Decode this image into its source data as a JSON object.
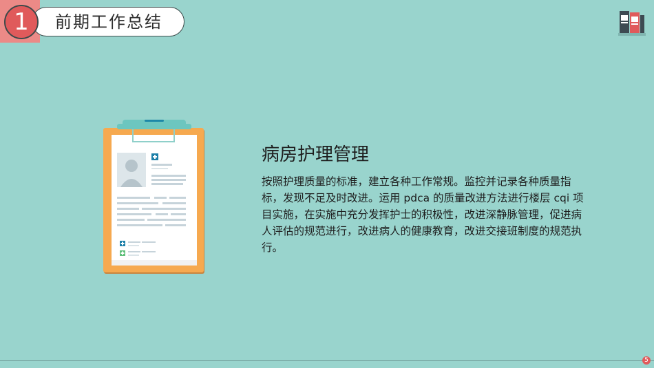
{
  "header": {
    "section_number": "1",
    "title": "前期工作总结"
  },
  "content": {
    "heading": "病房护理管理",
    "body": "按照护理质量的标准，建立各种工作常规。监控并记录各种质量指标，发现不足及时改进。运用 pdca 的质量改进方法进行楼层 cqi 项目实施，在实施中充分发挥护士的积极性，改进深静脉管理，促进病人评估的规范进行，改进病人的健康教育，改进交接班制度的规范执行。"
  },
  "footer": {
    "page_number": "5"
  },
  "colors": {
    "background": "#99d4cd",
    "accent_red": "#e05a5b",
    "accent_pink": "#ec8a87",
    "clipboard_orange": "#f6a94f",
    "clip_teal": "#6cc6bf"
  },
  "icons": {
    "top_right": "books-icon",
    "illustration": "clipboard-icon"
  }
}
